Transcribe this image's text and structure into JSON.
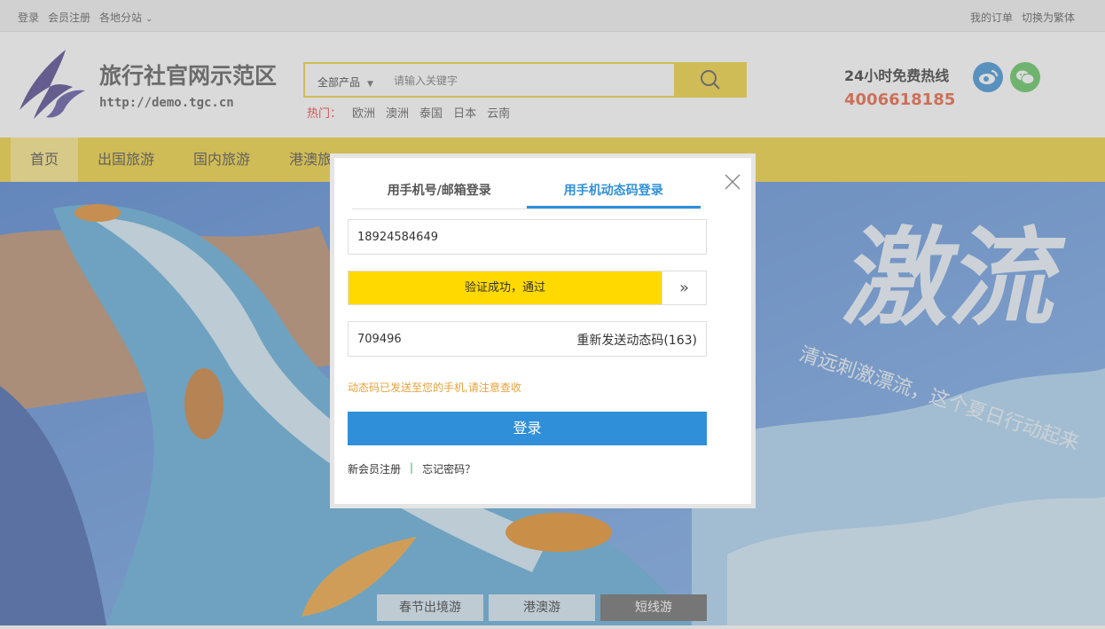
{
  "topbar": {
    "login": "登录",
    "register": "会员注册",
    "branches": "各地分站",
    "my_orders": "我的订单",
    "traditional": "切换为繁体"
  },
  "header": {
    "site_name": "旅行社官网示范区",
    "site_url": "http://demo.tgc.cn",
    "search": {
      "category": "全部产品",
      "placeholder": "请输入关键字"
    },
    "hot": {
      "label": "热门：",
      "items": [
        "欧洲",
        "澳洲",
        "泰国",
        "日本",
        "云南"
      ]
    },
    "hotline_title": "24小时免费热线",
    "hotline_number": "4006618185"
  },
  "nav": {
    "items": [
      "首页",
      "出国旅游",
      "国内旅游",
      "港澳旅"
    ]
  },
  "banner": {
    "tabs": [
      "春节出境游",
      "港澳游",
      "短线游"
    ]
  },
  "login_modal": {
    "tab_account": "用手机号/邮箱登录",
    "tab_sms": "用手机动态码登录",
    "phone_value": "18924584649",
    "slider_text": "验证成功，通过",
    "slider_handle": "»",
    "slider_progress": 0.875,
    "code_value": "709496",
    "resend_label": "重新发送动态码(163)",
    "hint": "动态码已发送至您的手机,请注意查收",
    "login_button": "登录",
    "register_link": "新会员注册",
    "separator": "|",
    "forgot_link": "忘记密码？"
  },
  "colors": {
    "accent_yellow": "#f0d135",
    "primary_blue": "#2f8fd8",
    "hotline_orange": "#e85d3a",
    "hint_orange": "#e9a23b"
  }
}
